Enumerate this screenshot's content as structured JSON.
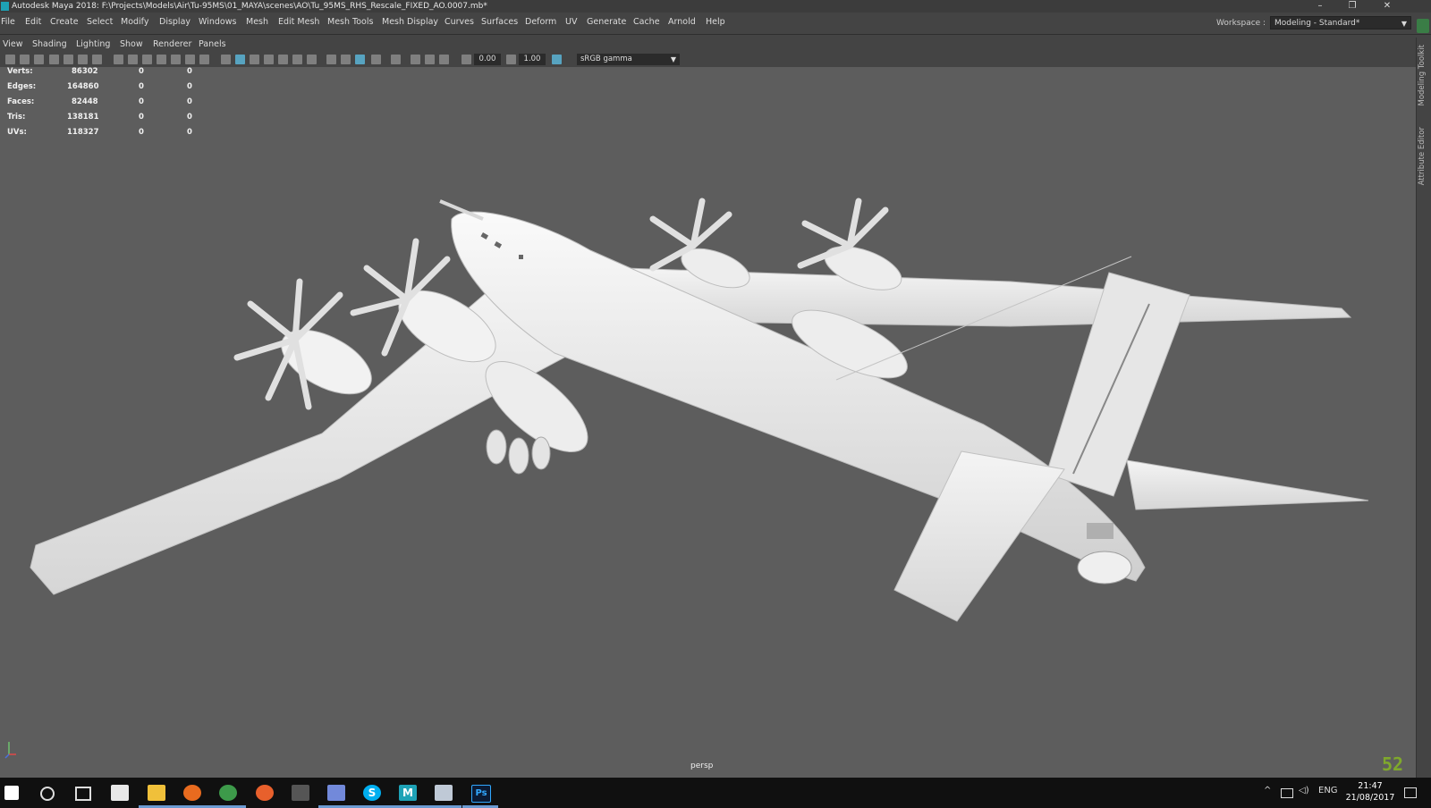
{
  "window": {
    "title": "Autodesk Maya 2018: F:\\Projects\\Models\\Air\\Tu-95MS\\01_MAYA\\scenes\\AO\\Tu_95MS_RHS_Rescale_FIXED_AO.0007.mb*",
    "minimize": "–",
    "restore": "❐",
    "close": "✕"
  },
  "menubar": {
    "items": [
      "File",
      "Edit",
      "Create",
      "Select",
      "Modify",
      "Display",
      "Windows",
      "Mesh",
      "Edit Mesh",
      "Mesh Tools",
      "Mesh Display",
      "Curves",
      "Surfaces",
      "Deform",
      "UV",
      "Generate",
      "Cache",
      "Arnold",
      "Help"
    ],
    "workspace_label": "Workspace :",
    "workspace_value": "Modeling - Standard*"
  },
  "panel_menu": {
    "items": [
      "View",
      "Shading",
      "Lighting",
      "Show",
      "Renderer",
      "Panels"
    ]
  },
  "toolbar": {
    "exposure": "0.00",
    "gamma": "1.00",
    "color_space": "sRGB gamma"
  },
  "hud": {
    "rows": [
      {
        "label": "Verts:",
        "value": "86302",
        "sel": "0",
        "comp": "0"
      },
      {
        "label": "Edges:",
        "value": "164860",
        "sel": "0",
        "comp": "0"
      },
      {
        "label": "Faces:",
        "value": "82448",
        "sel": "0",
        "comp": "0"
      },
      {
        "label": "Tris:",
        "value": "138181",
        "sel": "0",
        "comp": "0"
      },
      {
        "label": "UVs:",
        "value": "118327",
        "sel": "0",
        "comp": "0"
      }
    ]
  },
  "viewport": {
    "camera": "persp",
    "corner_logo": "52"
  },
  "side_dock": {
    "tabs": [
      "Modeling Toolkit",
      "Attribute Editor"
    ]
  },
  "taskbar": {
    "language": "ENG",
    "time": "21:47",
    "date": "21/08/2017",
    "apps": [
      "start-icon",
      "search-icon",
      "task-view-icon",
      "mail-icon",
      "file-explorer-icon",
      "firefox-icon",
      "chrome-icon",
      "app-orange-icon",
      "app-dark-icon",
      "discord-icon",
      "skype-icon",
      "maya-icon",
      "photo-viewer-icon",
      "photoshop-icon"
    ],
    "photoshop_label": "Ps",
    "maya_label": "M",
    "skype_label": "S"
  },
  "colors": {
    "viewport_bg": "#5d5d5d",
    "ui_bg": "#444444",
    "maya_accent": "#1ea2b6",
    "logo_green": "#7fa82c"
  }
}
